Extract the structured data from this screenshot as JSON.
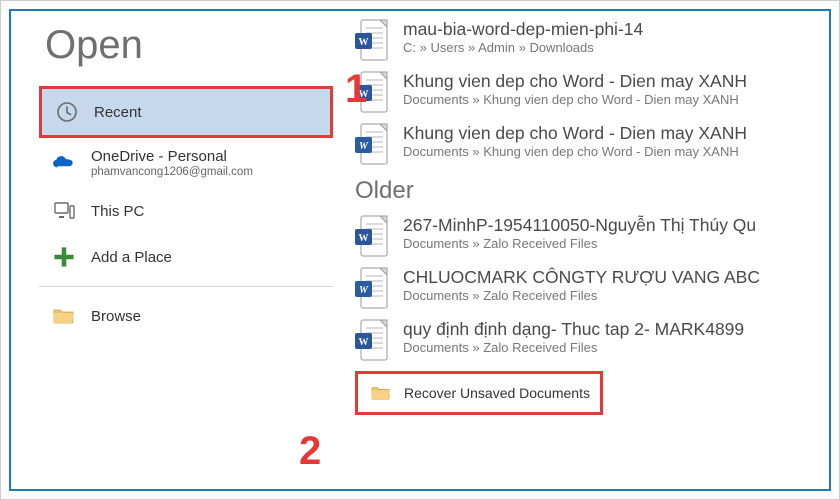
{
  "page": {
    "title": "Open"
  },
  "nav": {
    "recent": {
      "label": "Recent"
    },
    "onedrive": {
      "label": "OneDrive - Personal",
      "sub": "phamvancong1206@gmail.com"
    },
    "thispc": {
      "label": "This PC"
    },
    "addplace": {
      "label": "Add a Place"
    },
    "browse": {
      "label": "Browse"
    }
  },
  "files": {
    "recent": [
      {
        "title": "mau-bia-word-dep-mien-phi-14",
        "path": "C: » Users » Admin » Downloads",
        "variant": "word-new"
      },
      {
        "title": "Khung vien dep cho Word - Dien may XANH",
        "path": "Documents » Khung vien dep cho Word - Dien may XANH",
        "variant": "word-new"
      },
      {
        "title": "Khung vien dep cho Word - Dien may XANH",
        "path": "Documents » Khung vien dep cho Word - Dien may XANH",
        "variant": "word-old"
      }
    ],
    "olderHeader": "Older",
    "older": [
      {
        "title": "267-MinhP-1954110050-Nguyễn Thị Thúy Qu",
        "path": "Documents » Zalo Received Files",
        "variant": "word-new"
      },
      {
        "title": "CHLUOCMARK CÔNGTY RƯỢU VANG ABC",
        "path": "Documents » Zalo Received Files",
        "variant": "word-old"
      },
      {
        "title": "quy định định dạng- Thuc tap 2- MARK4899",
        "path": "Documents » Zalo Received Files",
        "variant": "word-new"
      }
    ]
  },
  "recover": {
    "label": "Recover Unsaved Documents"
  },
  "callouts": {
    "one": "1",
    "two": "2"
  }
}
